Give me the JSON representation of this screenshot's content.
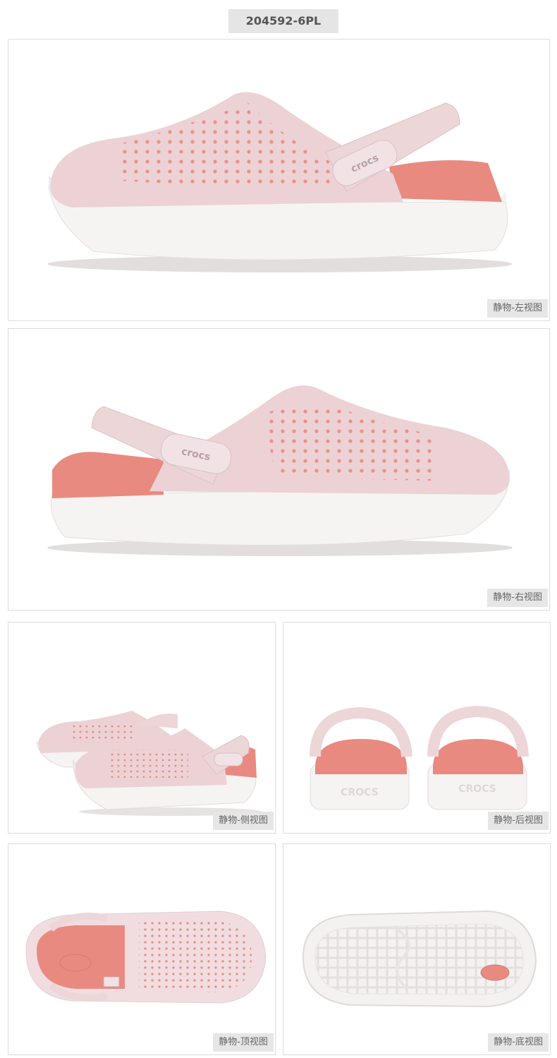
{
  "header": {
    "sku": "204592-6PL"
  },
  "logo": {
    "strap": "crocs",
    "heel": "CROCS"
  },
  "colors": {
    "upper": "#ecd2d5",
    "sole": "#f4f2f1",
    "accent": "#e98a80",
    "label_bg": "#e6e6e6"
  },
  "views": [
    {
      "label": "静物-左视图"
    },
    {
      "label": "静物-右视图"
    },
    {
      "label": "静物-侧视图"
    },
    {
      "label": "静物-后视图"
    },
    {
      "label": "静物-顶视图"
    },
    {
      "label": "静物-底视图"
    }
  ]
}
